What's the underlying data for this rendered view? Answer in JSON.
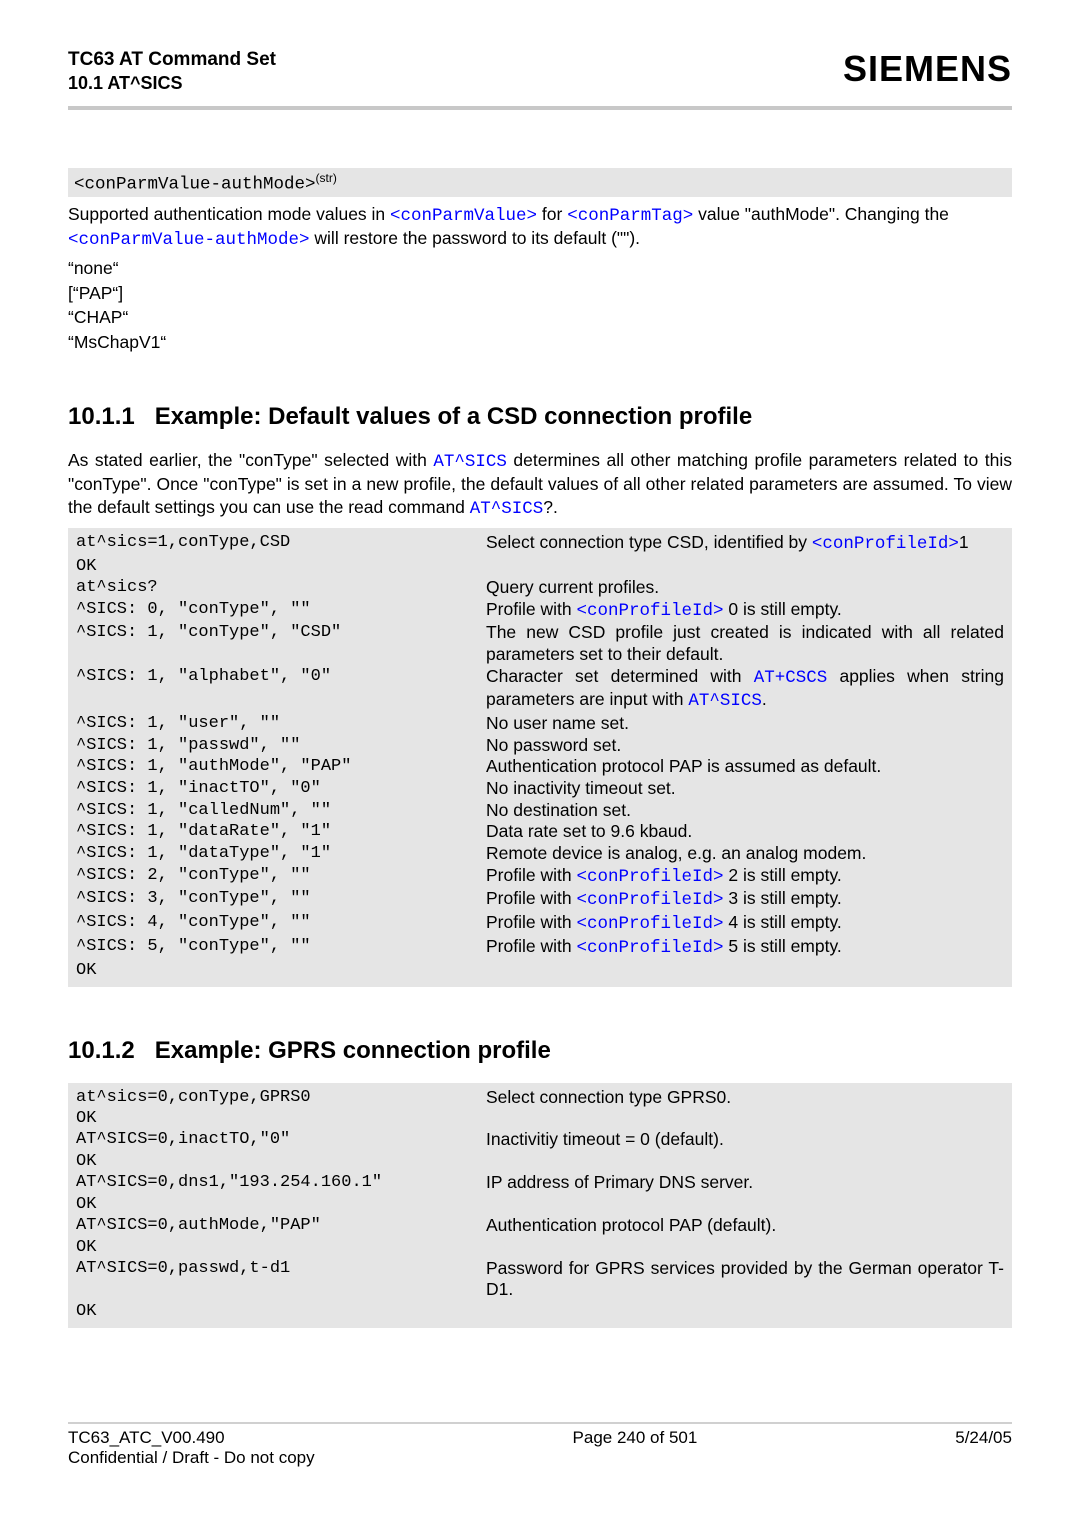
{
  "header": {
    "title": "TC63 AT Command Set",
    "subtitle": "10.1 AT^SICS",
    "brand": "SIEMENS"
  },
  "param": {
    "name": "<conParmValue-authMode>",
    "sup": "(str)",
    "desc_pre": "Supported authentication mode values in ",
    "desc_l1": "<conParmValue>",
    "desc_mid1": " for ",
    "desc_l2": "<conParmTag>",
    "desc_mid2": " value \"authMode\". Changing the ",
    "desc_l3": "<conParmValue-authMode>",
    "desc_post": " will restore the password to its default (\"\").",
    "values": [
      "“none“",
      "[“PAP“]",
      "“CHAP“",
      "“MsChapV1“"
    ]
  },
  "s1": {
    "num": "10.1.1",
    "title": "Example: Default values of a CSD connection profile",
    "intro_a": "As stated earlier, the \"conType\" selected with ",
    "intro_link1": "AT^SICS",
    "intro_b": " determines all other matching profile parameters related to this \"conType\". Once \"conType\" is set in a new profile, the default values of all other related parameters are assumed. To view the default settings you can use the read command ",
    "intro_link2": "AT^SICS",
    "intro_c": "?.",
    "rows": [
      {
        "l": "at^sics=1,conType,CSD",
        "r_pre": "Select connection type CSD, identified by ",
        "r_link": "<conProfileId>",
        "r_post": "1"
      },
      {
        "l": "OK",
        "r_pre": "",
        "r_link": "",
        "r_post": ""
      },
      {
        "l": "at^sics?",
        "r_pre": "Query current profiles.",
        "r_link": "",
        "r_post": ""
      },
      {
        "l": "^SICS: 0, \"conType\", \"\"",
        "r_pre": "Profile with ",
        "r_link": "<conProfileId>",
        "r_post": " 0 is still empty."
      },
      {
        "l": "^SICS: 1, \"conType\", \"CSD\"",
        "r_pre": "The new CSD profile just created is indicated with all related parameters set to their default.",
        "r_link": "",
        "r_post": ""
      },
      {
        "l": "^SICS: 1, \"alphabet\", \"0\"",
        "r_pre": "Character set determined with ",
        "r_link": "AT+CSCS",
        "r_post": " applies when string parameters are input with ",
        "r_link2": "AT^SICS",
        "r_post2": "."
      },
      {
        "l": "^SICS: 1, \"user\", \"\"",
        "r_pre": "No user name set.",
        "r_link": "",
        "r_post": ""
      },
      {
        "l": "^SICS: 1, \"passwd\", \"\"",
        "r_pre": "No password set.",
        "r_link": "",
        "r_post": ""
      },
      {
        "l": "^SICS: 1, \"authMode\", \"PAP\"",
        "r_pre": "Authentication protocol PAP is assumed as default.",
        "r_link": "",
        "r_post": ""
      },
      {
        "l": "^SICS: 1, \"inactTO\", \"0\"",
        "r_pre": "No inactivity timeout set.",
        "r_link": "",
        "r_post": ""
      },
      {
        "l": "^SICS: 1, \"calledNum\", \"\"",
        "r_pre": "No destination set.",
        "r_link": "",
        "r_post": ""
      },
      {
        "l": "^SICS: 1, \"dataRate\", \"1\"",
        "r_pre": "Data rate set to 9.6 kbaud.",
        "r_link": "",
        "r_post": ""
      },
      {
        "l": "^SICS: 1, \"dataType\", \"1\"",
        "r_pre": "Remote device is analog, e.g. an analog modem.",
        "r_link": "",
        "r_post": ""
      },
      {
        "l": "^SICS: 2, \"conType\", \"\"",
        "r_pre": "Profile with ",
        "r_link": "<conProfileId>",
        "r_post": " 2 is still empty."
      },
      {
        "l": "^SICS: 3, \"conType\", \"\"",
        "r_pre": "Profile with ",
        "r_link": "<conProfileId>",
        "r_post": " 3 is still empty."
      },
      {
        "l": "^SICS: 4, \"conType\", \"\"",
        "r_pre": "Profile with ",
        "r_link": "<conProfileId>",
        "r_post": " 4 is still empty."
      },
      {
        "l": "^SICS: 5, \"conType\", \"\"",
        "r_pre": "Profile with ",
        "r_link": "<conProfileId>",
        "r_post": " 5 is still empty."
      },
      {
        "l": "OK",
        "r_pre": "",
        "r_link": "",
        "r_post": ""
      }
    ]
  },
  "s2": {
    "num": "10.1.2",
    "title": "Example: GPRS connection profile",
    "rows": [
      {
        "l": "at^sics=0,conType,GPRS0",
        "r": "Select connection type GPRS0."
      },
      {
        "l": "OK",
        "r": ""
      },
      {
        "l": "AT^SICS=0,inactTO,\"0\"",
        "r": "Inactivitiy timeout = 0 (default)."
      },
      {
        "l": "OK",
        "r": ""
      },
      {
        "l": "AT^SICS=0,dns1,\"193.254.160.1\"",
        "r": "IP address of Primary DNS server."
      },
      {
        "l": "OK",
        "r": ""
      },
      {
        "l": "AT^SICS=0,authMode,\"PAP\"",
        "r": "Authentication protocol PAP (default)."
      },
      {
        "l": "OK",
        "r": ""
      },
      {
        "l": "AT^SICS=0,passwd,t-d1",
        "r": "Password for GPRS services provided by the German operator T-D1."
      },
      {
        "l": "OK",
        "r": ""
      }
    ]
  },
  "footer": {
    "left1": "TC63_ATC_V00.490",
    "center": "Page 240 of 501",
    "right": "5/24/05",
    "left2": "Confidential / Draft - Do not copy"
  }
}
